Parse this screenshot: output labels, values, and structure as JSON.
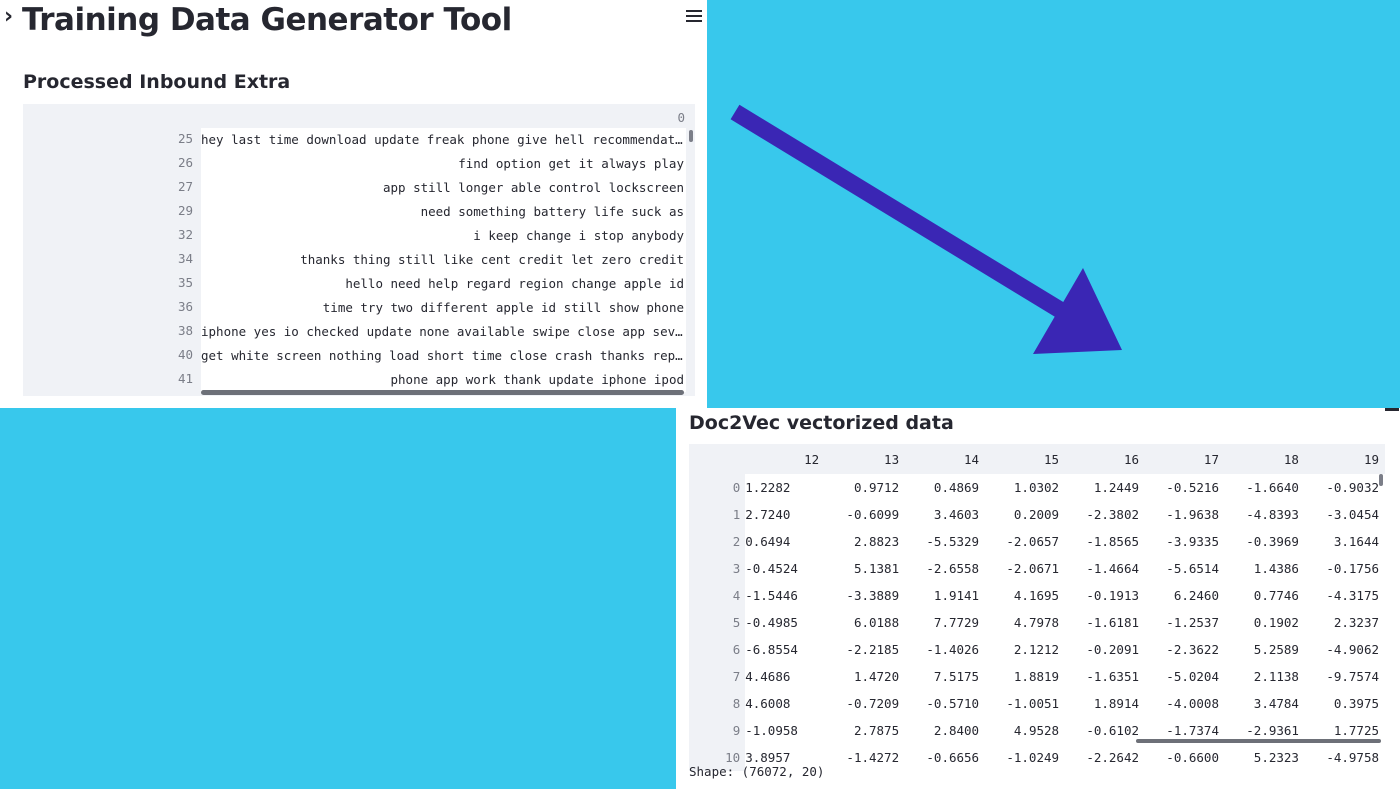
{
  "top_panel": {
    "app_title": "Training Data Generator Tool",
    "section_title": "Processed Inbound Extra",
    "column_header": "0",
    "rows": [
      {
        "index": "25",
        "text": "hey last time download update freak phone give hell recommendati…"
      },
      {
        "index": "26",
        "text": "find option get it always play"
      },
      {
        "index": "27",
        "text": "app still longer able control lockscreen"
      },
      {
        "index": "29",
        "text": "need something battery life suck as"
      },
      {
        "index": "32",
        "text": "i keep change i stop   anybody"
      },
      {
        "index": "34",
        "text": "thanks thing still like cent credit let zero credit"
      },
      {
        "index": "35",
        "text": "hello need help regard region change apple id"
      },
      {
        "index": "36",
        "text": "time try two different apple id still show phone"
      },
      {
        "index": "38",
        "text": "iphone yes io checked update none available swipe close app seve…"
      },
      {
        "index": "40",
        "text": "get white screen nothing load short time close crash thanks reply"
      },
      {
        "index": "41",
        "text": "phone app work thank update iphone ipod"
      }
    ]
  },
  "bottom_panel": {
    "section_title": "Doc2Vec vectorized data",
    "columns": [
      "12",
      "13",
      "14",
      "15",
      "16",
      "17",
      "18",
      "19"
    ],
    "rows": [
      {
        "index": "0",
        "values": [
          "1.2282",
          "0.9712",
          "0.4869",
          "1.0302",
          "1.2449",
          "-0.5216",
          "-1.6640",
          "-0.9032"
        ]
      },
      {
        "index": "1",
        "values": [
          "2.7240",
          "-0.6099",
          "3.4603",
          "0.2009",
          "-2.3802",
          "-1.9638",
          "-4.8393",
          "-3.0454"
        ]
      },
      {
        "index": "2",
        "values": [
          "0.6494",
          "2.8823",
          "-5.5329",
          "-2.0657",
          "-1.8565",
          "-3.9335",
          "-0.3969",
          "3.1644"
        ]
      },
      {
        "index": "3",
        "values": [
          "-0.4524",
          "5.1381",
          "-2.6558",
          "-2.0671",
          "-1.4664",
          "-5.6514",
          "1.4386",
          "-0.1756"
        ]
      },
      {
        "index": "4",
        "values": [
          "-1.5446",
          "-3.3889",
          "1.9141",
          "4.1695",
          "-0.1913",
          "6.2460",
          "0.7746",
          "-4.3175"
        ]
      },
      {
        "index": "5",
        "values": [
          "-0.4985",
          "6.0188",
          "7.7729",
          "4.7978",
          "-1.6181",
          "-1.2537",
          "0.1902",
          "2.3237"
        ]
      },
      {
        "index": "6",
        "values": [
          "-6.8554",
          "-2.2185",
          "-1.4026",
          "2.1212",
          "-0.2091",
          "-2.3622",
          "5.2589",
          "-4.9062"
        ]
      },
      {
        "index": "7",
        "values": [
          "4.4686",
          "1.4720",
          "7.5175",
          "1.8819",
          "-1.6351",
          "-5.0204",
          "2.1138",
          "-9.7574"
        ]
      },
      {
        "index": "8",
        "values": [
          "4.6008",
          "-0.7209",
          "-0.5710",
          "-1.0051",
          "1.8914",
          "-4.0008",
          "3.4784",
          "0.3975"
        ]
      },
      {
        "index": "9",
        "values": [
          "-1.0958",
          "2.7875",
          "2.8400",
          "4.9528",
          "-0.6102",
          "-1.7374",
          "-2.9361",
          "1.7725"
        ]
      },
      {
        "index": "10",
        "values": [
          "3.8957",
          "-1.4272",
          "-0.6656",
          "-1.0249",
          "-2.2642",
          "-0.6600",
          "5.2323",
          "-4.9758"
        ]
      }
    ],
    "shape_label": "Shape: (76072, 20)"
  },
  "colors": {
    "background": "#38c8ec",
    "arrow": "#3a26b4",
    "frame_bg": "#f0f2f6"
  },
  "icons": [
    "chevron-right-icon",
    "hamburger-menu-icon"
  ]
}
